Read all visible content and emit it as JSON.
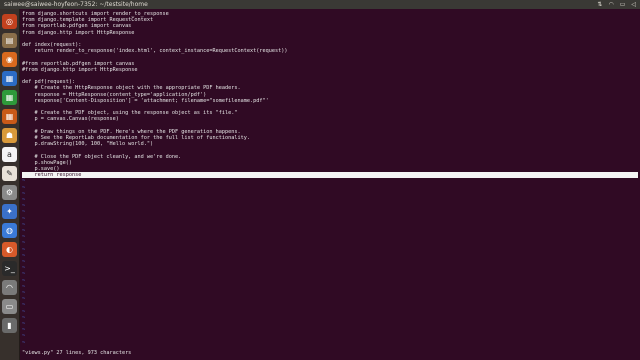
{
  "topbar": {
    "title": "saiwee@saiwee-hoyfeon-7352: ~/testsite/home",
    "tray_icons": [
      "sort-icon",
      "network-icon",
      "battery-icon",
      "volume-icon"
    ]
  },
  "launcher": {
    "items": [
      {
        "name": "dash-icon",
        "glyph": "◎",
        "color": "#c2411e"
      },
      {
        "name": "files-icon",
        "glyph": "▤",
        "color": "#8a6f4a"
      },
      {
        "name": "firefox-icon",
        "glyph": "◉",
        "color": "#d86a1e"
      },
      {
        "name": "writer-icon",
        "glyph": "▦",
        "color": "#2b6cc4"
      },
      {
        "name": "calc-icon",
        "glyph": "▦",
        "color": "#2e9a3a"
      },
      {
        "name": "impress-icon",
        "glyph": "▦",
        "color": "#c85a18"
      },
      {
        "name": "software-center-icon",
        "glyph": "☗",
        "color": "#d89a3a"
      },
      {
        "name": "amazon-icon",
        "glyph": "a",
        "color": "#f5f5f5"
      },
      {
        "name": "text-editor-icon",
        "glyph": "✎",
        "color": "#e9e2d8"
      },
      {
        "name": "settings-icon",
        "glyph": "⚙",
        "color": "#8a8a8a"
      },
      {
        "name": "tools-icon",
        "glyph": "✦",
        "color": "#3a70c8"
      },
      {
        "name": "chromium-icon",
        "glyph": "◍",
        "color": "#3a7ad8"
      },
      {
        "name": "app-icon",
        "glyph": "◐",
        "color": "#d85a2a"
      },
      {
        "name": "terminal-icon",
        "glyph": ">_",
        "color": "#2a2a2a"
      },
      {
        "name": "headphones-icon",
        "glyph": "◠",
        "color": "#7a7a7a"
      },
      {
        "name": "disk-icon",
        "glyph": "▭",
        "color": "#8a8a8a"
      },
      {
        "name": "trash-icon",
        "glyph": "▮",
        "color": "#6a6a6a"
      }
    ]
  },
  "editor": {
    "lines": [
      "from django.shortcuts import render_to_response",
      "from django.template import RequestContext",
      "from reportlab.pdfgen import canvas",
      "from django.http import HttpResponse",
      "",
      "def index(request):",
      "    return render_to_response('index.html', context_instance=RequestContext(request))",
      "",
      "#from reportlab.pdfgen import canvas",
      "#from django.http import HttpResponse",
      "",
      "def pdf(request):",
      "    # Create the HttpResponse object with the appropriate PDF headers.",
      "    response = HttpResponse(content_type='application/pdf')",
      "    response['Content-Disposition'] = 'attachment; filename=\"somefilename.pdf\"'",
      "",
      "    # Create the PDF object, using the response object as its \"file.\"",
      "    p = canvas.Canvas(response)",
      "",
      "    # Draw things on the PDF. Here's where the PDF generation happens.",
      "    # See the ReportLab documentation for the full list of functionality.",
      "    p.drawString(100, 100, \"Hello world.\")",
      "",
      "    # Close the PDF object cleanly, and we're done.",
      "    p.showPage()",
      "    p.save()",
      "    return response"
    ],
    "cursor_line_index": 26,
    "tilde": "~",
    "status": "\"views.py\" 27 lines, 973 characters"
  }
}
